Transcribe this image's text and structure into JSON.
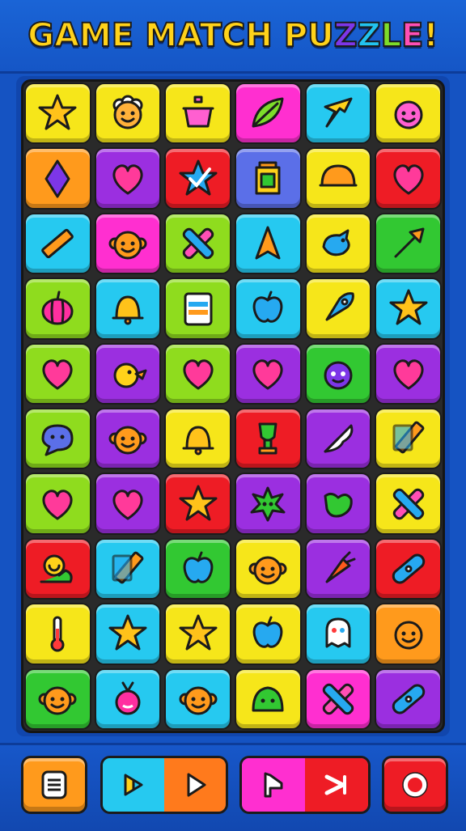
{
  "header": {
    "title_main": "GAME MATCH ",
    "title_pu": "PU",
    "title_z1": "Z",
    "title_z2": "Z",
    "title_l": "L",
    "title_e": "E",
    "title_bang": "!"
  },
  "colors": {
    "yellow": "#f6e61a",
    "purple": "#9b2fe0",
    "red": "#ee1c25",
    "blue": "#5b6fe8",
    "cyan": "#26c9f0",
    "green": "#32c832",
    "lime": "#8fdc1e",
    "orange": "#ff9a1c",
    "magenta": "#ff2fd0"
  },
  "board": {
    "rows": [
      [
        {
          "color": "yellow",
          "icon": "star-icon"
        },
        {
          "color": "yellow",
          "icon": "sheep-face-icon"
        },
        {
          "color": "yellow",
          "icon": "pot-icon"
        },
        {
          "color": "magenta",
          "icon": "leaf-icon"
        },
        {
          "color": "cyan",
          "icon": "star-shard-icon"
        },
        {
          "color": "yellow",
          "icon": "smiley-blob-icon"
        }
      ],
      [
        {
          "color": "orange",
          "icon": "diamond-icon"
        },
        {
          "color": "purple",
          "icon": "heart-icon"
        },
        {
          "color": "red",
          "icon": "star-check-icon"
        },
        {
          "color": "blue",
          "icon": "lantern-icon"
        },
        {
          "color": "yellow",
          "icon": "helmet-icon"
        },
        {
          "color": "red",
          "icon": "heart-icon"
        }
      ],
      [
        {
          "color": "cyan",
          "icon": "ruler-icon"
        },
        {
          "color": "magenta",
          "icon": "monkey-face-icon"
        },
        {
          "color": "lime",
          "icon": "cross-icon"
        },
        {
          "color": "cyan",
          "icon": "arrow-up-icon"
        },
        {
          "color": "yellow",
          "icon": "bird-icon"
        },
        {
          "color": "green",
          "icon": "arrow-diagonal-icon"
        }
      ],
      [
        {
          "color": "lime",
          "icon": "pumpkin-icon"
        },
        {
          "color": "cyan",
          "icon": "bell-icon"
        },
        {
          "color": "lime",
          "icon": "clipboard-icon"
        },
        {
          "color": "cyan",
          "icon": "apple-icon"
        },
        {
          "color": "yellow",
          "icon": "rocket-icon"
        },
        {
          "color": "cyan",
          "icon": "star-icon"
        }
      ],
      [
        {
          "color": "lime",
          "icon": "heart-icon"
        },
        {
          "color": "purple",
          "icon": "duck-icon"
        },
        {
          "color": "lime",
          "icon": "heart-icon"
        },
        {
          "color": "purple",
          "icon": "heart-icon"
        },
        {
          "color": "green",
          "icon": "fuzzy-monster-icon"
        },
        {
          "color": "purple",
          "icon": "heart-icon"
        }
      ],
      [
        {
          "color": "lime",
          "icon": "speech-blob-icon"
        },
        {
          "color": "purple",
          "icon": "monkey-face-icon"
        },
        {
          "color": "yellow",
          "icon": "bell-icon"
        },
        {
          "color": "red",
          "icon": "trophy-icon"
        },
        {
          "color": "purple",
          "icon": "feather-pen-icon"
        },
        {
          "color": "yellow",
          "icon": "pencil-icon"
        }
      ],
      [
        {
          "color": "lime",
          "icon": "heart-icon"
        },
        {
          "color": "purple",
          "icon": "heart-icon"
        },
        {
          "color": "red",
          "icon": "star-icon"
        },
        {
          "color": "purple",
          "icon": "splat-icon"
        },
        {
          "color": "purple",
          "icon": "candy-icon"
        },
        {
          "color": "yellow",
          "icon": "cross-icon"
        }
      ],
      [
        {
          "color": "red",
          "icon": "snail-icon"
        },
        {
          "color": "cyan",
          "icon": "pencil-icon"
        },
        {
          "color": "green",
          "icon": "apple-icon"
        },
        {
          "color": "yellow",
          "icon": "monkey-face-icon"
        },
        {
          "color": "purple",
          "icon": "carrot-icon"
        },
        {
          "color": "red",
          "icon": "bandage-icon"
        }
      ],
      [
        {
          "color": "yellow",
          "icon": "thermometer-icon"
        },
        {
          "color": "cyan",
          "icon": "star-icon"
        },
        {
          "color": "yellow",
          "icon": "star-icon"
        },
        {
          "color": "yellow",
          "icon": "apple-icon"
        },
        {
          "color": "cyan",
          "icon": "ghost-icon"
        },
        {
          "color": "orange",
          "icon": "smiley-icon"
        }
      ],
      [
        {
          "color": "green",
          "icon": "monkey-face-icon"
        },
        {
          "color": "cyan",
          "icon": "radish-icon"
        },
        {
          "color": "cyan",
          "icon": "monkey-face-icon"
        },
        {
          "color": "yellow",
          "icon": "slime-icon"
        },
        {
          "color": "magenta",
          "icon": "cross-icon"
        },
        {
          "color": "purple",
          "icon": "bandage-icon"
        }
      ]
    ]
  },
  "footer": {
    "buttons": [
      {
        "name": "menu-button",
        "icon": "menu-list-icon"
      },
      {
        "name": "play-pair-button",
        "icon": "play-icon"
      },
      {
        "name": "next-pair-button",
        "icon": "skip-icon"
      },
      {
        "name": "record-button",
        "icon": "circle-icon"
      }
    ]
  }
}
